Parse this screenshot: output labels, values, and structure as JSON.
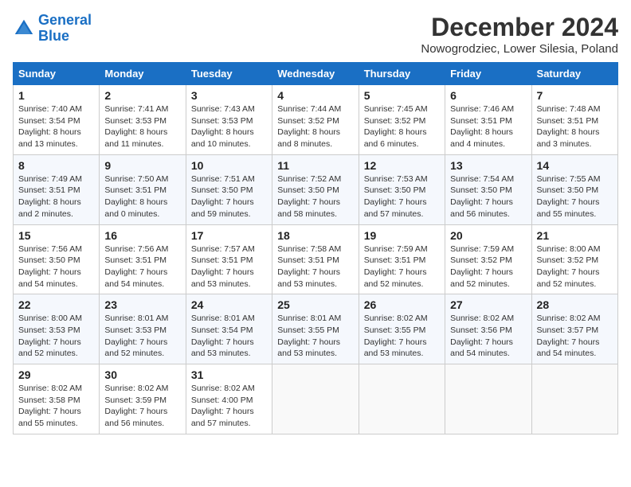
{
  "logo": {
    "line1": "General",
    "line2": "Blue"
  },
  "title": "December 2024",
  "location": "Nowogrodziec, Lower Silesia, Poland",
  "weekdays": [
    "Sunday",
    "Monday",
    "Tuesday",
    "Wednesday",
    "Thursday",
    "Friday",
    "Saturday"
  ],
  "weeks": [
    [
      {
        "day": "1",
        "info": "Sunrise: 7:40 AM\nSunset: 3:54 PM\nDaylight: 8 hours\nand 13 minutes."
      },
      {
        "day": "2",
        "info": "Sunrise: 7:41 AM\nSunset: 3:53 PM\nDaylight: 8 hours\nand 11 minutes."
      },
      {
        "day": "3",
        "info": "Sunrise: 7:43 AM\nSunset: 3:53 PM\nDaylight: 8 hours\nand 10 minutes."
      },
      {
        "day": "4",
        "info": "Sunrise: 7:44 AM\nSunset: 3:52 PM\nDaylight: 8 hours\nand 8 minutes."
      },
      {
        "day": "5",
        "info": "Sunrise: 7:45 AM\nSunset: 3:52 PM\nDaylight: 8 hours\nand 6 minutes."
      },
      {
        "day": "6",
        "info": "Sunrise: 7:46 AM\nSunset: 3:51 PM\nDaylight: 8 hours\nand 4 minutes."
      },
      {
        "day": "7",
        "info": "Sunrise: 7:48 AM\nSunset: 3:51 PM\nDaylight: 8 hours\nand 3 minutes."
      }
    ],
    [
      {
        "day": "8",
        "info": "Sunrise: 7:49 AM\nSunset: 3:51 PM\nDaylight: 8 hours\nand 2 minutes."
      },
      {
        "day": "9",
        "info": "Sunrise: 7:50 AM\nSunset: 3:51 PM\nDaylight: 8 hours\nand 0 minutes."
      },
      {
        "day": "10",
        "info": "Sunrise: 7:51 AM\nSunset: 3:50 PM\nDaylight: 7 hours\nand 59 minutes."
      },
      {
        "day": "11",
        "info": "Sunrise: 7:52 AM\nSunset: 3:50 PM\nDaylight: 7 hours\nand 58 minutes."
      },
      {
        "day": "12",
        "info": "Sunrise: 7:53 AM\nSunset: 3:50 PM\nDaylight: 7 hours\nand 57 minutes."
      },
      {
        "day": "13",
        "info": "Sunrise: 7:54 AM\nSunset: 3:50 PM\nDaylight: 7 hours\nand 56 minutes."
      },
      {
        "day": "14",
        "info": "Sunrise: 7:55 AM\nSunset: 3:50 PM\nDaylight: 7 hours\nand 55 minutes."
      }
    ],
    [
      {
        "day": "15",
        "info": "Sunrise: 7:56 AM\nSunset: 3:50 PM\nDaylight: 7 hours\nand 54 minutes."
      },
      {
        "day": "16",
        "info": "Sunrise: 7:56 AM\nSunset: 3:51 PM\nDaylight: 7 hours\nand 54 minutes."
      },
      {
        "day": "17",
        "info": "Sunrise: 7:57 AM\nSunset: 3:51 PM\nDaylight: 7 hours\nand 53 minutes."
      },
      {
        "day": "18",
        "info": "Sunrise: 7:58 AM\nSunset: 3:51 PM\nDaylight: 7 hours\nand 53 minutes."
      },
      {
        "day": "19",
        "info": "Sunrise: 7:59 AM\nSunset: 3:51 PM\nDaylight: 7 hours\nand 52 minutes."
      },
      {
        "day": "20",
        "info": "Sunrise: 7:59 AM\nSunset: 3:52 PM\nDaylight: 7 hours\nand 52 minutes."
      },
      {
        "day": "21",
        "info": "Sunrise: 8:00 AM\nSunset: 3:52 PM\nDaylight: 7 hours\nand 52 minutes."
      }
    ],
    [
      {
        "day": "22",
        "info": "Sunrise: 8:00 AM\nSunset: 3:53 PM\nDaylight: 7 hours\nand 52 minutes."
      },
      {
        "day": "23",
        "info": "Sunrise: 8:01 AM\nSunset: 3:53 PM\nDaylight: 7 hours\nand 52 minutes."
      },
      {
        "day": "24",
        "info": "Sunrise: 8:01 AM\nSunset: 3:54 PM\nDaylight: 7 hours\nand 53 minutes."
      },
      {
        "day": "25",
        "info": "Sunrise: 8:01 AM\nSunset: 3:55 PM\nDaylight: 7 hours\nand 53 minutes."
      },
      {
        "day": "26",
        "info": "Sunrise: 8:02 AM\nSunset: 3:55 PM\nDaylight: 7 hours\nand 53 minutes."
      },
      {
        "day": "27",
        "info": "Sunrise: 8:02 AM\nSunset: 3:56 PM\nDaylight: 7 hours\nand 54 minutes."
      },
      {
        "day": "28",
        "info": "Sunrise: 8:02 AM\nSunset: 3:57 PM\nDaylight: 7 hours\nand 54 minutes."
      }
    ],
    [
      {
        "day": "29",
        "info": "Sunrise: 8:02 AM\nSunset: 3:58 PM\nDaylight: 7 hours\nand 55 minutes."
      },
      {
        "day": "30",
        "info": "Sunrise: 8:02 AM\nSunset: 3:59 PM\nDaylight: 7 hours\nand 56 minutes."
      },
      {
        "day": "31",
        "info": "Sunrise: 8:02 AM\nSunset: 4:00 PM\nDaylight: 7 hours\nand 57 minutes."
      },
      null,
      null,
      null,
      null
    ]
  ]
}
